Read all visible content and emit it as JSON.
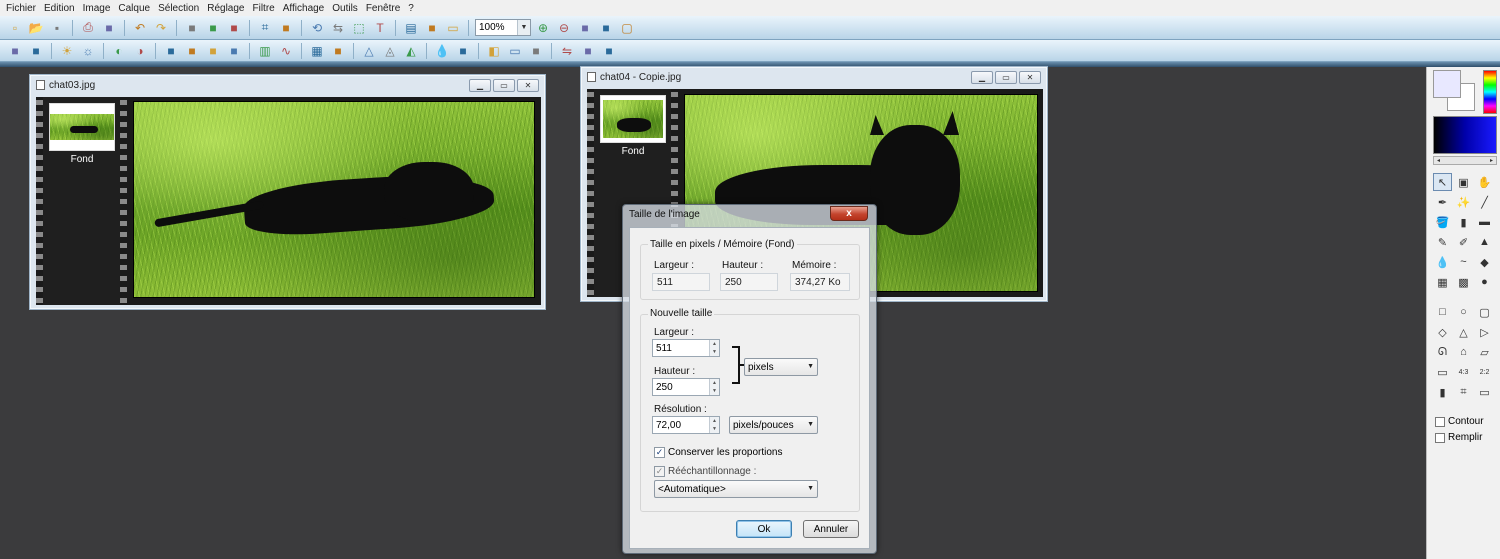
{
  "menu": [
    "Fichier",
    "Edition",
    "Image",
    "Calque",
    "Sélection",
    "Réglage",
    "Filtre",
    "Affichage",
    "Outils",
    "Fenêtre",
    "?"
  ],
  "toolbar": {
    "zoom_value": "100%",
    "row1_icons": [
      "new-icon",
      "open-icon",
      "save-icon",
      "sep",
      "print-icon",
      "scan-icon",
      "sep",
      "undo-icon",
      "redo-icon",
      "sep",
      "copy-layer-icon",
      "paste-layer-icon",
      "merge-icon",
      "sep",
      "crop-icon",
      "canvas-icon",
      "sep",
      "rotate-icon",
      "flip-icon",
      "select-icon",
      "text-icon",
      "sep",
      "layers-icon",
      "effects-icon",
      "window-icon"
    ],
    "row1_tail_icons": [
      "zoom-in-icon",
      "zoom-out-icon",
      "fit-window-icon",
      "actual-size-icon",
      "fullscreen-icon"
    ],
    "row2_icons": [
      "auto-levels-icon",
      "auto-contrast-icon",
      "sep",
      "brightness-up-icon",
      "brightness-down-icon",
      "sep",
      "contrast-up-icon",
      "contrast-down-icon",
      "sep",
      "gamma-up-icon",
      "gamma-down-icon",
      "color-balance-icon",
      "desaturate-icon",
      "sep",
      "levels-icon",
      "curves-icon",
      "sep",
      "grid-icon",
      "noise-icon",
      "sep",
      "sharpen-icon",
      "blur-icon",
      "soften-icon",
      "sep",
      "drop-icon",
      "dropper-icon",
      "sep",
      "palette-icon",
      "monitor-icon",
      "filter-icon",
      "sep",
      "mirror-icon",
      "print-preview-icon",
      "export-icon"
    ]
  },
  "windows": [
    {
      "title": "chat03.jpg",
      "layer_label": "Fond"
    },
    {
      "title": "chat04 - Copie.jpg",
      "layer_label": "Fond"
    }
  ],
  "dialog": {
    "title": "Taille de l'image",
    "close_label": "x",
    "current": {
      "group_label": "Taille en pixels / Mémoire (Fond)",
      "width_label": "Largeur :",
      "width_value": "511",
      "height_label": "Hauteur :",
      "height_value": "250",
      "memory_label": "Mémoire :",
      "memory_value": "374,27 Ko"
    },
    "new": {
      "group_label": "Nouvelle taille",
      "width_label": "Largeur :",
      "width_value": "511",
      "height_label": "Hauteur :",
      "height_value": "250",
      "unit": "pixels",
      "resolution_label": "Résolution :",
      "resolution_value": "72,00",
      "resolution_unit": "pixels/pouces",
      "keep_proportions_label": "Conserver les proportions",
      "keep_proportions_checked": true,
      "resample_label": "Rééchantillonnage :",
      "resample_checked": true,
      "resample_method": "<Automatique>"
    },
    "ok_label": "Ok",
    "cancel_label": "Annuler"
  },
  "tools_panel": {
    "contour_label": "Contour",
    "fill_label": "Remplir",
    "tools": [
      "pointer-icon",
      "layer-move-icon",
      "hand-icon",
      "eyedropper-icon",
      "magic-wand-icon",
      "line-icon",
      "fill-bucket-icon",
      "spray-icon",
      "eraser-icon",
      "brush-icon",
      "clone-icon",
      "stamp-icon",
      "drop-icon",
      "smudge-icon",
      "red-eye-icon",
      "pattern-icon",
      "portrait-icon",
      "strawberry-icon"
    ],
    "shapes": [
      "rectangle-icon",
      "ellipse-icon",
      "rounded-rect-icon",
      "diamond-icon",
      "triangle-icon",
      "play-triangle-icon",
      "lasso-icon",
      "polygon-icon",
      "folder-icon",
      "rect-select-icon",
      "ratio-4-3-icon",
      "ratio-2-2-icon",
      "column-icon",
      "transform-icon",
      "window-icon"
    ]
  }
}
